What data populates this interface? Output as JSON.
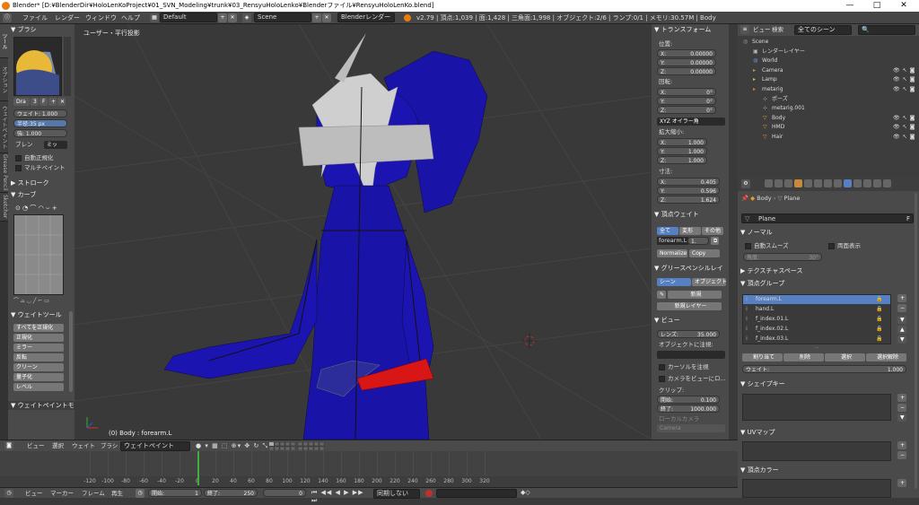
{
  "title_bar": {
    "title": "Blender* [D:¥BlenderDir¥HoloLenKoProject¥01_SVN_Modeling¥trunk¥03_RensyuHoloLenko¥Blenderファイル¥RensyuHoloLenKo.blend]",
    "minimize": "—",
    "maximize": "□",
    "close": "✕"
  },
  "info_bar": {
    "menus": [
      "ファイル",
      "レンダー",
      "ウィンドウ",
      "ヘルプ"
    ],
    "layout": "Default",
    "scene": "Scene",
    "engine": "Blenderレンダー",
    "stats": "v2.79 | 頂点:1,039 | 面:1,428 | 三角面:1,998 | オブジェクト:2/6 | ランプ:0/1 | メモリ:30.57M | Body"
  },
  "tool_shelf": {
    "tabs": [
      "ツール",
      "オプション",
      "ウェイトペイント",
      "Grease Pencil",
      "Sketcher"
    ],
    "brush_header": "ブラシ",
    "brush_name": "Dra",
    "brush_users": "3",
    "brush_f": "F",
    "weight": "ウェイト: 1.000",
    "radius": "半径:35 px",
    "strength": "強: 1.000",
    "blend_label": "ブレン",
    "blend_value": "ミッ",
    "auto_normalize": "自動正規化",
    "multi_paint": "マルチペイント",
    "stroke_header": "ストローク",
    "curve_header": "カーブ",
    "weight_tools_header": "ウェイトツール",
    "weight_tools": [
      "すべてを正規化",
      "正規化",
      "ミラー",
      "反転",
      "クリーン",
      "量子化",
      "レベル"
    ],
    "footer": "ウェイトペイントモード"
  },
  "viewport": {
    "view_label": "ユーザー・平行投影",
    "object_label": "(0) Body : forearm.L",
    "header_items": [
      "ビュー",
      "選択",
      "ウェイト",
      "ブラシ"
    ],
    "mode": "ウェイトペイント"
  },
  "properties_n": {
    "transform_header": "トランスフォーム",
    "location_label": "位置:",
    "location": [
      {
        "axis": "X:",
        "value": "0.00000"
      },
      {
        "axis": "Y:",
        "value": "0.00000"
      },
      {
        "axis": "Z:",
        "value": "0.00000"
      }
    ],
    "rotation_label": "回転:",
    "rotation": [
      {
        "axis": "X:",
        "value": "0°"
      },
      {
        "axis": "Y:",
        "value": "0°"
      },
      {
        "axis": "Z:",
        "value": "0°"
      }
    ],
    "rotation_mode": "XYZ オイラー角",
    "scale_label": "拡大縮小:",
    "scale": [
      {
        "axis": "X:",
        "value": "1.000"
      },
      {
        "axis": "Y:",
        "value": "1.000"
      },
      {
        "axis": "Z:",
        "value": "1.000"
      }
    ],
    "dimensions_label": "寸法:",
    "dimensions": [
      {
        "axis": "X:",
        "value": "0.405"
      },
      {
        "axis": "Y:",
        "value": "0.596"
      },
      {
        "axis": "Z:",
        "value": "1.624"
      }
    ],
    "vweights_header": "頂点ウェイト",
    "vw_tabs": [
      "全て",
      "変形",
      "その他"
    ],
    "vw_group": "forearm.L",
    "vw_value": "1.",
    "normalize": "Normalize",
    "copy": "Copy",
    "grease_header": "グリースペンシルレイ",
    "grease_tabs": [
      "シーン",
      "オブジェクト"
    ],
    "new_btn": "新規",
    "new_layer_btn": "新規レイヤー",
    "view_header": "ビュー",
    "lens": "レンズ:",
    "lens_value": "35.000",
    "lock_to_object": "オブジェクトに注視:",
    "lock_cursor": "カーソルを注視",
    "lock_camera": "カメラをビューにロ...",
    "clip_label": "クリップ:",
    "clip_start": "開始:",
    "clip_start_value": "0.100",
    "clip_end": "終了:",
    "clip_end_value": "1000.000",
    "local_camera": "ローカルカメラ",
    "camera": "Camera"
  },
  "outliner": {
    "menus": [
      "ビュー",
      "検索"
    ],
    "filter": "全てのシーン",
    "items": [
      {
        "label": "Scene",
        "indent": 0
      },
      {
        "label": "レンダーレイヤー",
        "indent": 1
      },
      {
        "label": "World",
        "indent": 1
      },
      {
        "label": "Camera",
        "indent": 1
      },
      {
        "label": "Lamp",
        "indent": 1
      },
      {
        "label": "metarig",
        "indent": 1
      },
      {
        "label": "ポーズ",
        "indent": 2
      },
      {
        "label": "metarig.001",
        "indent": 2
      },
      {
        "label": "Body",
        "indent": 2
      },
      {
        "label": "HMD",
        "indent": 2
      },
      {
        "label": "Hair",
        "indent": 2
      }
    ]
  },
  "properties": {
    "breadcrumb": [
      "Body",
      "Plane"
    ],
    "mesh_name": "Plane",
    "mesh_f": "F",
    "normals_header": "ノーマル",
    "auto_smooth": "自動スムーズ",
    "double_sided": "両面表示",
    "angle": "角度:",
    "angle_value": "30°",
    "texture_space_header": "テクスチャスペース",
    "vgroups_header": "頂点グループ",
    "vgroups": [
      "forearm.L",
      "hand.L",
      "f_index.01.L",
      "f_index.02.L",
      "f_index.03.L"
    ],
    "assign": "割り当て",
    "remove": "削除",
    "select": "選択",
    "deselect": "選択解除",
    "weight": "ウェイト:",
    "weight_value": "1.000",
    "shape_keys_header": "シェイプキー",
    "uv_maps_header": "UVマップ",
    "vertex_colors_header": "頂点カラー"
  },
  "timeline": {
    "ticks": [
      "-120",
      "-100",
      "-80",
      "-60",
      "-40",
      "-20",
      "0",
      "20",
      "40",
      "60",
      "80",
      "100",
      "120",
      "140",
      "160",
      "180",
      "200",
      "220",
      "240",
      "260",
      "280",
      "300",
      "320"
    ],
    "menus": [
      "ビュー",
      "マーカー",
      "フレーム",
      "再生"
    ],
    "start_label": "開始:",
    "start_value": "1",
    "end_label": "終了:",
    "end_value": "250",
    "current": "0",
    "sync": "同期しない"
  },
  "colors": {
    "accent": "#5680c2",
    "mesh": "#1a13a8",
    "bone_selected": "#d81616"
  }
}
